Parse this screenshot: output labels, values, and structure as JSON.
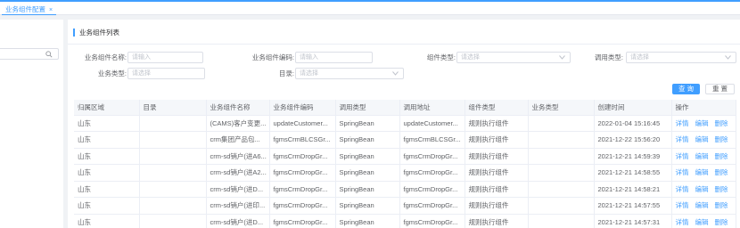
{
  "tab": {
    "label": "业务组件配置",
    "close_glyph": "×"
  },
  "panel_title": "业务组件列表",
  "filters": {
    "name": {
      "label": "业务组件名称:",
      "placeholder": "请输入"
    },
    "code": {
      "label": "业务组件编码:",
      "placeholder": "请输入"
    },
    "component_type": {
      "label": "组件类型:",
      "placeholder": "请选择"
    },
    "call_type": {
      "label": "调用类型:",
      "placeholder": "请选择"
    },
    "business_type": {
      "label": "业务类型:",
      "placeholder": "请选择"
    },
    "directory": {
      "label": "目录:",
      "placeholder": "请选择"
    }
  },
  "buttons": {
    "query": "查 询",
    "reset": "重 置"
  },
  "table": {
    "headers": [
      "归属区域",
      "目录",
      "业务组件名称",
      "业务组件编码",
      "调用类型",
      "调用地址",
      "组件类型",
      "业务类型",
      "创建时间",
      "操作"
    ],
    "actions": [
      "详情",
      "编辑",
      "删除"
    ],
    "rows": [
      [
        "山东",
        "",
        "(CAMS)客户变更...",
        "updateCustomer...",
        "SpringBean",
        "updateCustomer...",
        "规则执行组件",
        "",
        "2022-01-04 15:16:45"
      ],
      [
        "山东",
        "",
        "crm集团产品包...",
        "fgmsCrmBLCSGr...",
        "SpringBean",
        "fgmsCrmBLCSGr...",
        "规则执行组件",
        "",
        "2021-12-22 15:56:20"
      ],
      [
        "山东",
        "",
        "crm-sd销户(进A6...",
        "fgmsCrmDropGr...",
        "SpringBean",
        "fgmsCrmDropGr...",
        "规则执行组件",
        "",
        "2021-12-21 14:59:39"
      ],
      [
        "山东",
        "",
        "crm-sd销户(进A2...",
        "fgmsCrmDropGr...",
        "SpringBean",
        "fgmsCrmDropGr...",
        "规则执行组件",
        "",
        "2021-12-21 14:58:55"
      ],
      [
        "山东",
        "",
        "crm-sd销户(进D...",
        "fgmsCrmDropGr...",
        "SpringBean",
        "fgmsCrmDropGr...",
        "规则执行组件",
        "",
        "2021-12-21 14:58:21"
      ],
      [
        "山东",
        "",
        "crm-sd销户(进印...",
        "fgmsCrmDropGr...",
        "SpringBean",
        "fgmsCrmDropGr...",
        "规则执行组件",
        "",
        "2021-12-21 14:57:55"
      ],
      [
        "山东",
        "",
        "crm-sd销户(进D...",
        "fgmsCrmDropGr...",
        "SpringBean",
        "fgmsCrmDropGr...",
        "规则执行组件",
        "",
        "2021-12-21 14:57:31"
      ]
    ]
  }
}
